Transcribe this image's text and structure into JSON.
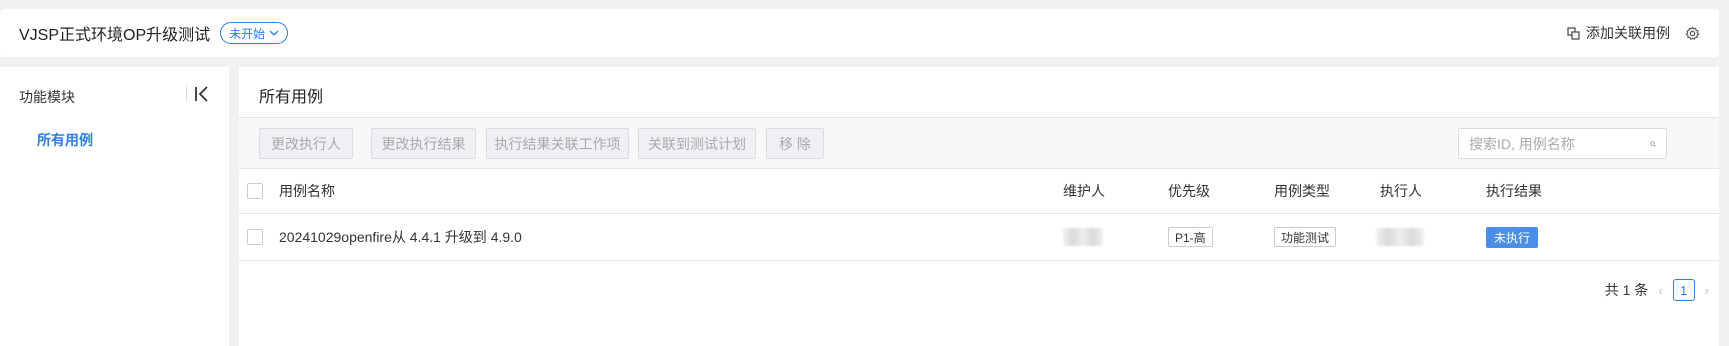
{
  "topbar": {
    "title": "VJSP正式环境OP升级测试",
    "status": "未开始",
    "add_link_label": "添加关联用例"
  },
  "sidebar": {
    "header": "功能模块",
    "items": [
      {
        "label": "所有用例"
      }
    ]
  },
  "main": {
    "title": "所有用例",
    "toolbar": {
      "buttons": [
        "更改执行人",
        "更改执行结果",
        "执行结果关联工作项",
        "关联到测试计划",
        "移 除"
      ],
      "search_placeholder": "搜索ID, 用例名称"
    },
    "table": {
      "columns": [
        "用例名称",
        "维护人",
        "优先级",
        "用例类型",
        "执行人",
        "执行结果"
      ],
      "rows": [
        {
          "name": "20241029openfire从 4.4.1 升级到 4.9.0",
          "priority": "P1-高",
          "case_type": "功能测试",
          "result": "未执行"
        }
      ]
    },
    "pagination": {
      "total": "共 1 条",
      "current_page": "1"
    }
  },
  "colors": {
    "accent": "#2b7de9",
    "result_badge": "#4a8ee6"
  }
}
